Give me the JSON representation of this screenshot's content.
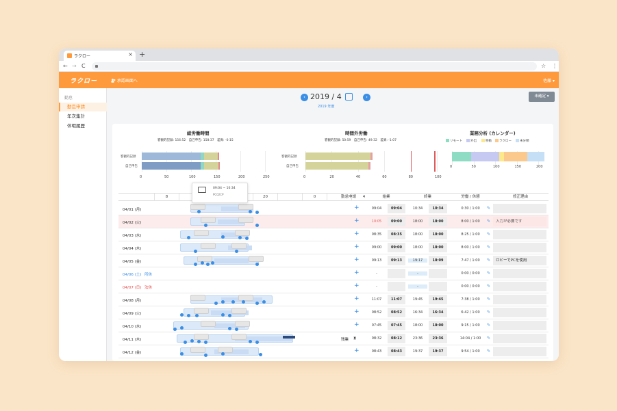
{
  "browser": {
    "tab_title": "ラクロー",
    "tab_close": "×",
    "new_tab": "+",
    "nav_back": "←",
    "nav_forward": "→",
    "nav_reload": "C",
    "star": "☆",
    "menu": "⋮"
  },
  "appbar": {
    "logo": "ラクロー",
    "approval": "承認画面へ",
    "user": "佐藤 ▾"
  },
  "sidebar": {
    "heading": "勤怠",
    "items": [
      {
        "label": "勤怠申請"
      },
      {
        "label": "年次集計"
      },
      {
        "label": "休暇履歴"
      }
    ]
  },
  "header": {
    "prev": "‹",
    "next": "›",
    "year_month": "2019 / 4",
    "fiscal_year": "2019 年度",
    "confirm_button": "未確定 ▾"
  },
  "charts": {
    "total": {
      "title": "総労働時間",
      "summary": "客観的記録: 156:52　自己申告: 158:37　差異: -0:15",
      "rows": [
        "客観的記録",
        "自己申告"
      ],
      "ticks": [
        "0",
        "50",
        "100",
        "150",
        "200",
        "250"
      ]
    },
    "overtime": {
      "title": "時間外労働",
      "summary": "客観的記録: 50:59　自己申告: 49:32　差異: -1:07",
      "rows": [
        "客観的記録",
        "自己申告"
      ],
      "ticks": [
        "0",
        "20",
        "40",
        "60",
        "80",
        "100"
      ]
    },
    "analysis": {
      "title": "業務分析 (カレンダー)",
      "legend": [
        {
          "label": "リモート",
          "color": "#8fdcc4"
        },
        {
          "label": "外出",
          "color": "#c6c9f2"
        },
        {
          "label": "移動",
          "color": "#fde88a"
        },
        {
          "label": "ラクロー",
          "color": "#fbc98c"
        },
        {
          "label": "未分類",
          "color": "#c5dff6"
        }
      ],
      "ticks": [
        "0",
        "50",
        "100",
        "150",
        "200"
      ]
    }
  },
  "chart_data": [
    {
      "type": "bar",
      "title": "総労働時間",
      "categories": [
        "客観的記録",
        "自己申告"
      ],
      "series": [
        {
          "values": [
            156.9,
            158.6
          ]
        }
      ],
      "xlim": [
        0,
        250
      ]
    },
    {
      "type": "bar",
      "title": "時間外労働",
      "categories": [
        "客観的記録",
        "自己申告"
      ],
      "series": [
        {
          "values": [
            51.0,
            49.5
          ]
        }
      ],
      "xlim": [
        0,
        100
      ]
    },
    {
      "type": "bar",
      "title": "業務分析 (カレンダー)",
      "categories": [
        ""
      ],
      "series": [
        {
          "name": "リモート",
          "values": [
            45
          ]
        },
        {
          "name": "外出",
          "values": [
            65
          ]
        },
        {
          "name": "移動",
          "values": [
            10
          ]
        },
        {
          "name": "ラクロー",
          "values": [
            55
          ]
        },
        {
          "name": "未分類",
          "values": [
            40
          ]
        }
      ],
      "xlim": [
        0,
        215
      ]
    }
  ],
  "table": {
    "hours": [
      "8",
      "",
      "",
      "",
      "20",
      "",
      "0",
      "",
      "4"
    ],
    "columns": [
      "勤怠申請",
      "始業",
      "終業",
      "労働 / 休憩",
      "修正理由"
    ],
    "tooltip": {
      "time": "09:04 ~ 10:34",
      "device": "PC02CP"
    },
    "plus": "+",
    "pencil": "✎",
    "rows": [
      {
        "date": "04/01 (月)",
        "holiday": "",
        "req": "",
        "s1": "09:04",
        "s2": "09:04",
        "e1": "10:34",
        "e2": "10:34",
        "work": "0:30 / 1:00",
        "reason": "",
        "kind": "weekday"
      },
      {
        "date": "04/02 (火)",
        "holiday": "",
        "req": "",
        "s1": "10:05",
        "s2": "09:00",
        "e1": "18:00",
        "e2": "18:00",
        "work": "8:00 / 1:00",
        "reason": "入力が必要です",
        "kind": "weekday"
      },
      {
        "date": "04/03 (水)",
        "holiday": "",
        "req": "",
        "s1": "08:35",
        "s2": "08:35",
        "e1": "18:00",
        "e2": "18:00",
        "work": "8:25 / 1:00",
        "reason": "",
        "kind": "weekday"
      },
      {
        "date": "04/04 (木)",
        "holiday": "",
        "req": "",
        "s1": "09:00",
        "s2": "09:00",
        "e1": "18:00",
        "e2": "18:00",
        "work": "8:00 / 1:00",
        "reason": "",
        "kind": "weekday"
      },
      {
        "date": "04/05 (金)",
        "holiday": "",
        "req": "",
        "s1": "09:13",
        "s2": "09:13",
        "e1": "19:17",
        "e2": "18:09",
        "work": "7:47 / 1:00",
        "reason": "ロビーでPCを使用",
        "kind": "weekday"
      },
      {
        "date": "04/06 (土)",
        "holiday": "所休",
        "req": "",
        "s1": "-",
        "s2": "",
        "e1": "-",
        "e2": "",
        "work": "0:00 / 0:00",
        "reason": "",
        "kind": "sat"
      },
      {
        "date": "04/07 (日)",
        "holiday": "法休",
        "req": "",
        "s1": "-",
        "s2": "",
        "e1": "-",
        "e2": "",
        "work": "0:00 / 0:00",
        "reason": "",
        "kind": "sun"
      },
      {
        "date": "04/08 (月)",
        "holiday": "",
        "req": "",
        "s1": "11:07",
        "s2": "11:07",
        "e1": "19:45",
        "e2": "19:45",
        "work": "7:38 / 1:00",
        "reason": "",
        "kind": "weekday"
      },
      {
        "date": "04/09 (火)",
        "holiday": "",
        "req": "",
        "s1": "08:52",
        "s2": "08:52",
        "e1": "16:34",
        "e2": "16:34",
        "work": "6:42 / 1:00",
        "reason": "",
        "kind": "weekday"
      },
      {
        "date": "04/10 (水)",
        "holiday": "",
        "req": "",
        "s1": "07:45",
        "s2": "07:45",
        "e1": "18:00",
        "e2": "18:00",
        "work": "9:15 / 1:00",
        "reason": "",
        "kind": "weekday"
      },
      {
        "date": "04/11 (木)",
        "holiday": "",
        "req": "残業",
        "s1": "08:32",
        "s2": "08:12",
        "e1": "23:36",
        "e2": "23:36",
        "work": "14:04 / 1:00",
        "reason": "",
        "kind": "weekday"
      },
      {
        "date": "04/12 (金)",
        "holiday": "",
        "req": "",
        "s1": "08:43",
        "s2": "08:43",
        "e1": "19:37",
        "e2": "19:37",
        "work": "9:54 / 1:00",
        "reason": "",
        "kind": "weekday"
      }
    ]
  }
}
